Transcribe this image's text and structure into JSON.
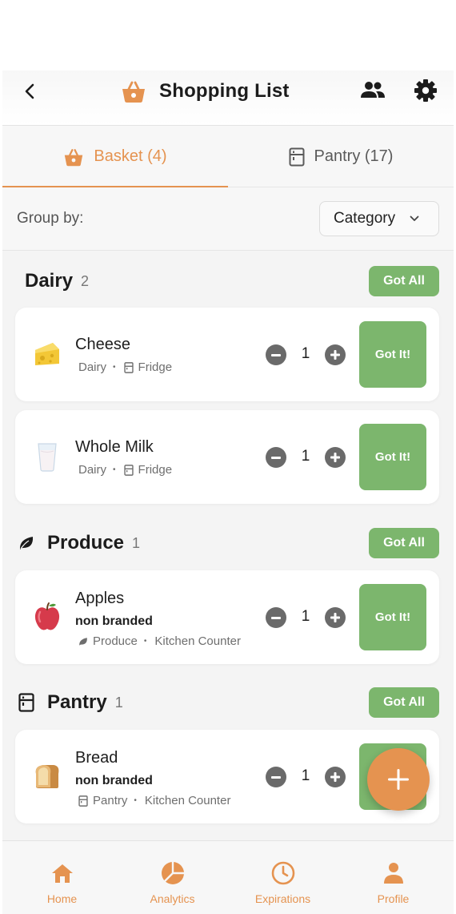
{
  "header": {
    "title": "Shopping List",
    "icons": {
      "back": "chevron-left-icon",
      "basket": "basket-icon",
      "share": "people-icon",
      "settings": "gear-icon"
    }
  },
  "tabs": [
    {
      "label": "Basket (4)",
      "icon": "basket-icon",
      "active": true
    },
    {
      "label": "Pantry (17)",
      "icon": "cabinet-icon",
      "active": false
    }
  ],
  "groupby": {
    "label": "Group by:",
    "selected": "Category"
  },
  "sections": [
    {
      "title": "Dairy",
      "count": "2",
      "action": "Got All",
      "items": [
        {
          "name": "Cheese",
          "brand": "",
          "category": "Dairy",
          "location": "Fridge",
          "qty": "1",
          "action": "Got It!",
          "emoji": "🧀"
        },
        {
          "name": "Whole Milk",
          "brand": "",
          "category": "Dairy",
          "location": "Fridge",
          "qty": "1",
          "action": "Got It!",
          "emoji": "🥛"
        }
      ]
    },
    {
      "title": "Produce",
      "count": "1",
      "action": "Got All",
      "items": [
        {
          "name": "Apples",
          "brand": "non branded",
          "category": "Produce",
          "location": "Kitchen Counter",
          "qty": "1",
          "action": "Got It!",
          "emoji": "🍎"
        }
      ]
    },
    {
      "title": "Pantry",
      "count": "1",
      "action": "Got All",
      "items": [
        {
          "name": "Bread",
          "brand": "non branded",
          "category": "Pantry",
          "location": "Kitchen Counter",
          "qty": "1",
          "action": "Got It!",
          "emoji": "🍞"
        }
      ]
    }
  ],
  "fab": {
    "icon": "plus-icon"
  },
  "nav": [
    {
      "label": "Home",
      "icon": "home-icon"
    },
    {
      "label": "Analytics",
      "icon": "pie-chart-icon"
    },
    {
      "label": "Expirations",
      "icon": "clock-icon"
    },
    {
      "label": "Profile",
      "icon": "person-icon"
    }
  ],
  "colors": {
    "accent": "#e59350",
    "success": "#7cb66d",
    "stepper": "#6a6a6a"
  }
}
